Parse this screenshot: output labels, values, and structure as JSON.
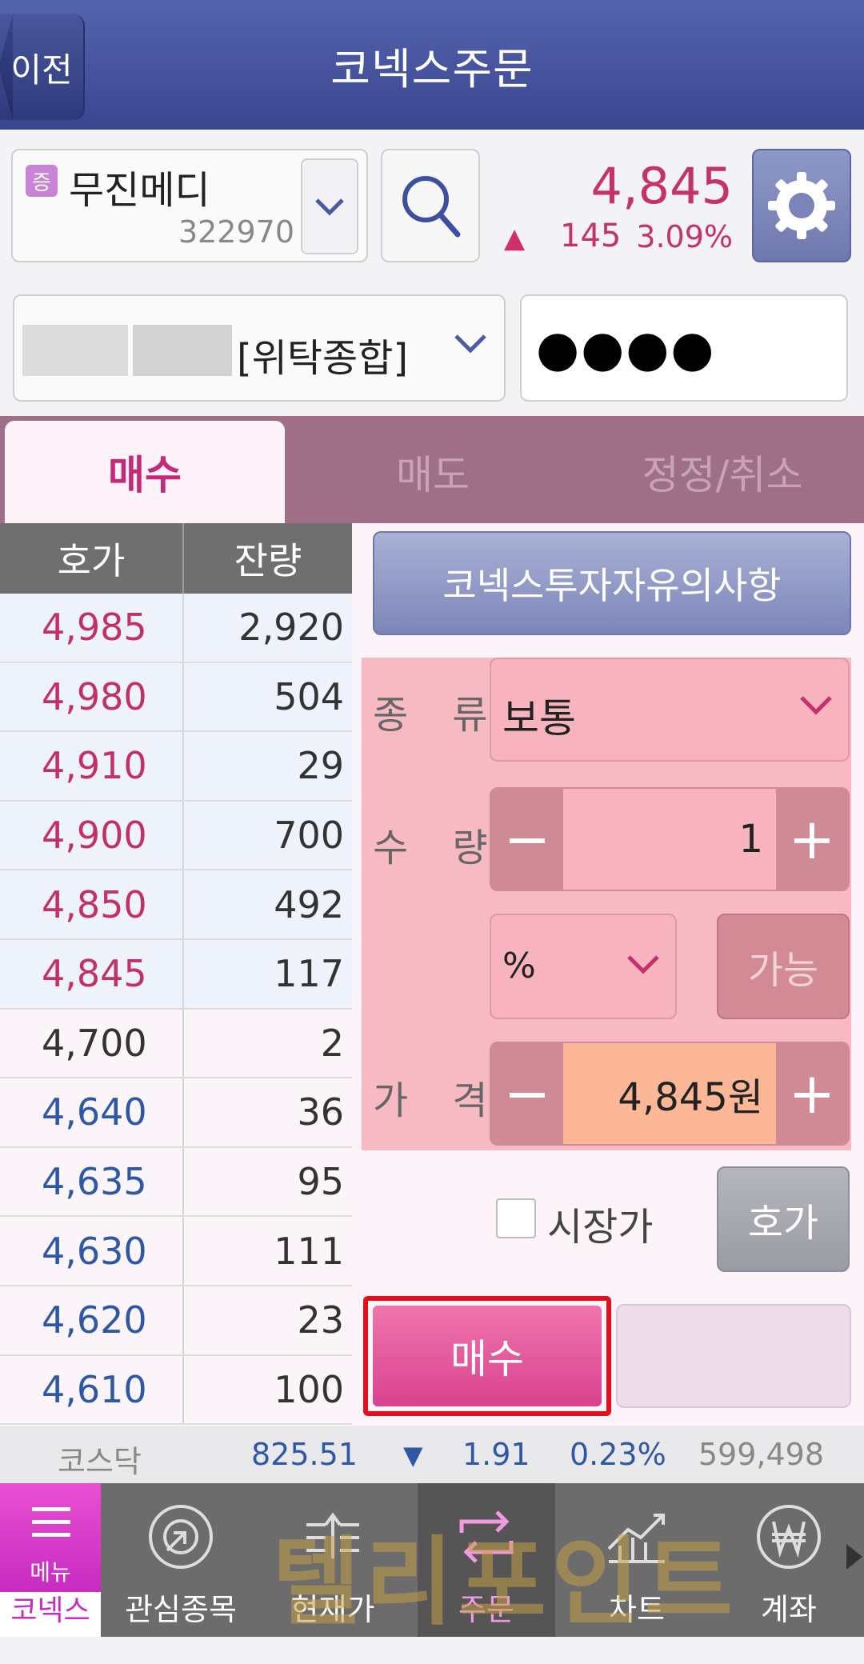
{
  "header": {
    "back_label": "이전",
    "title": "코넥스주문"
  },
  "stock": {
    "badge": "증",
    "name": "무진메디",
    "code": "322970",
    "price": "4,845",
    "change_arrow": "▲",
    "change": "145",
    "change_pct": "3.09%"
  },
  "account": {
    "type": "[위탁종합]",
    "password": "●●●●"
  },
  "tabs": [
    {
      "label": "매수"
    },
    {
      "label": "매도"
    },
    {
      "label": "정정/취소"
    }
  ],
  "orderbook": {
    "headers": {
      "price": "호가",
      "qty": "잔량"
    },
    "rows": [
      {
        "price": "4,985",
        "qty": "2,920"
      },
      {
        "price": "4,980",
        "qty": "504"
      },
      {
        "price": "4,910",
        "qty": "29"
      },
      {
        "price": "4,900",
        "qty": "700"
      },
      {
        "price": "4,850",
        "qty": "492"
      },
      {
        "price": "4,845",
        "qty": "117"
      },
      {
        "price": "4,700",
        "qty": "2"
      },
      {
        "price": "4,640",
        "qty": "36"
      },
      {
        "price": "4,635",
        "qty": "95"
      },
      {
        "price": "4,630",
        "qty": "111"
      },
      {
        "price": "4,620",
        "qty": "23"
      },
      {
        "price": "4,610",
        "qty": "100"
      }
    ]
  },
  "order": {
    "notice_button": "코넥스투자자유의사항",
    "type_label": "종 류",
    "type_value": "보통",
    "qty_label": "수 량",
    "qty_value": "1",
    "minus": "−",
    "plus": "+",
    "pct_value": "%",
    "able_button": "가능",
    "price_label": "가 격",
    "price_value": "4,845원",
    "market_label": "시장가",
    "hoga_button": "호가",
    "buy_button": "매수"
  },
  "index": {
    "name": "코스닥",
    "value": "825.51",
    "arrow": "▼",
    "change": "1.91",
    "pct": "0.23%",
    "volume": "599,498"
  },
  "nav": {
    "menu_label": "메뉴",
    "home_label": "코넥스",
    "items": [
      {
        "label": "관심종목"
      },
      {
        "label": "현재가"
      },
      {
        "label": "주문"
      },
      {
        "label": "차트"
      },
      {
        "label": "계좌"
      }
    ],
    "watermark": "텔리포인트"
  },
  "colors": {
    "header": "#3a4790",
    "accent_pink": "#c32a77",
    "ask_red": "#c33068",
    "bid_blue": "#2e58a6"
  }
}
